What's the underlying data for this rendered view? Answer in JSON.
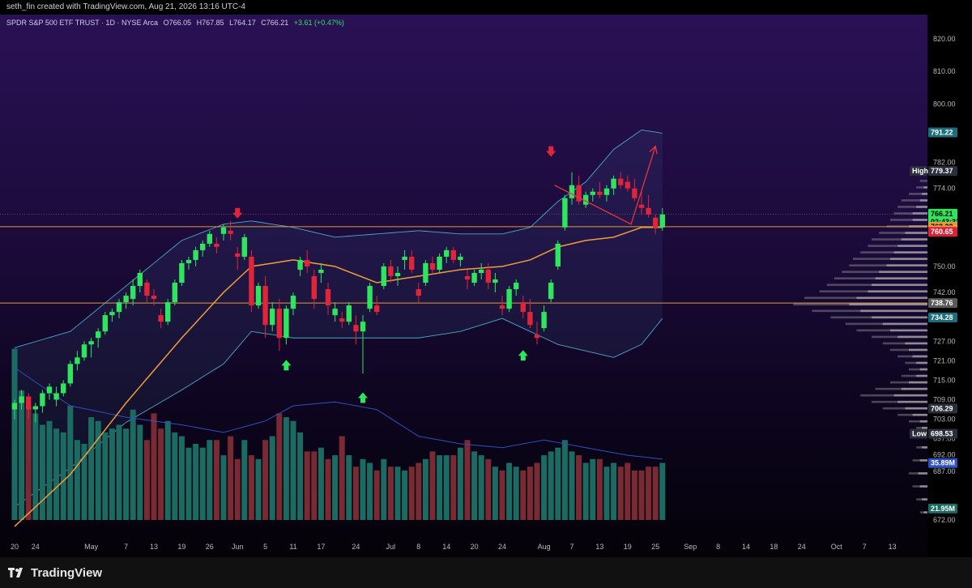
{
  "header": {
    "attribution": "seth_fin created with TradingView.com, Aug 21, 2026 13:16 UTC-4"
  },
  "footer": {
    "logo_text": "TradingView"
  },
  "colors": {
    "bull": "#2ee65e",
    "bear": "#e0243a",
    "bull_vol": "#1c6b62",
    "bear_vol": "#7a2a33",
    "sma": "#f29d38",
    "band": "#4aa8c8",
    "vol_ma": "#3050c0",
    "hline": "#e59a3a",
    "arrow": "#e8333f"
  },
  "chart_data": {
    "type": "candlestick",
    "symbol_line": "SPDR S&P 500 ETF TRUST · 1D · NYSE Arca",
    "ohlc_readout": {
      "O": "O766.05",
      "H": "H767.85",
      "L": "L764.17",
      "C": "C766.21",
      "change": "+3.61 (+0.47%)"
    },
    "ylim": [
      668,
      826
    ],
    "y_ticks": [
      820,
      810,
      800,
      782,
      774,
      750,
      742,
      727,
      721,
      715,
      709,
      703,
      697,
      692,
      687,
      672
    ],
    "x_ticks": [
      {
        "label": "20",
        "bar": 0
      },
      {
        "label": "24",
        "bar": 3
      },
      {
        "label": "May",
        "bar": 11
      },
      {
        "label": "7",
        "bar": 16
      },
      {
        "label": "13",
        "bar": 20
      },
      {
        "label": "19",
        "bar": 24
      },
      {
        "label": "26",
        "bar": 28
      },
      {
        "label": "Jun",
        "bar": 32
      },
      {
        "label": "5",
        "bar": 36
      },
      {
        "label": "11",
        "bar": 40
      },
      {
        "label": "17",
        "bar": 44
      },
      {
        "label": "24",
        "bar": 49
      },
      {
        "label": "Jul",
        "bar": 54
      },
      {
        "label": "8",
        "bar": 58
      },
      {
        "label": "14",
        "bar": 62
      },
      {
        "label": "20",
        "bar": 66
      },
      {
        "label": "24",
        "bar": 70
      },
      {
        "label": "Aug",
        "bar": 76
      },
      {
        "label": "7",
        "bar": 80
      },
      {
        "label": "13",
        "bar": 84
      },
      {
        "label": "19",
        "bar": 88
      },
      {
        "label": "25",
        "bar": 92
      },
      {
        "label": "Sep",
        "bar": 97
      },
      {
        "label": "8",
        "bar": 101
      },
      {
        "label": "14",
        "bar": 105
      },
      {
        "label": "18",
        "bar": 109
      },
      {
        "label": "24",
        "bar": 113
      },
      {
        "label": "Oct",
        "bar": 118
      },
      {
        "label": "7",
        "bar": 122
      },
      {
        "label": "13",
        "bar": 126
      }
    ],
    "candles": [
      [
        706,
        709,
        703,
        708
      ],
      [
        708,
        712,
        706,
        710
      ],
      [
        710,
        711,
        703,
        706
      ],
      [
        706,
        708,
        702,
        707
      ],
      [
        707,
        712,
        705,
        711
      ],
      [
        711,
        714,
        709,
        713
      ],
      [
        709,
        713,
        707,
        711
      ],
      [
        711,
        715,
        710,
        714
      ],
      [
        714,
        721,
        713,
        720
      ],
      [
        720,
        724,
        718,
        722
      ],
      [
        722,
        727,
        721,
        726
      ],
      [
        726,
        728,
        722,
        727
      ],
      [
        728,
        731,
        725,
        730
      ],
      [
        730,
        736,
        729,
        735
      ],
      [
        735,
        737,
        733,
        736
      ],
      [
        736,
        740,
        734,
        739
      ],
      [
        739,
        742,
        737,
        741
      ],
      [
        740,
        746,
        738,
        744
      ],
      [
        744,
        749,
        742,
        748
      ],
      [
        745,
        746,
        739,
        741
      ],
      [
        741,
        743,
        738,
        740
      ],
      [
        735,
        737,
        731,
        733
      ],
      [
        733,
        740,
        732,
        739
      ],
      [
        739,
        746,
        738,
        745
      ],
      [
        745,
        752,
        744,
        751
      ],
      [
        751,
        753,
        749,
        752
      ],
      [
        752,
        756,
        750,
        755
      ],
      [
        755,
        758,
        753,
        757
      ],
      [
        757,
        761,
        756,
        760
      ],
      [
        757,
        759,
        754,
        756
      ],
      [
        760,
        763,
        758,
        762
      ],
      [
        761,
        764,
        758,
        760
      ],
      [
        754,
        756,
        749,
        753
      ],
      [
        753,
        760,
        752,
        759
      ],
      [
        753,
        755,
        736,
        738
      ],
      [
        738,
        745,
        737,
        744
      ],
      [
        744,
        747,
        728,
        732
      ],
      [
        732,
        739,
        730,
        737
      ],
      [
        737,
        740,
        724,
        728
      ],
      [
        728,
        738,
        726,
        737
      ],
      [
        737,
        742,
        735,
        741
      ],
      [
        749,
        753,
        747,
        752
      ],
      [
        752,
        755,
        748,
        750
      ],
      [
        747,
        749,
        737,
        740
      ],
      [
        748,
        751,
        745,
        749
      ],
      [
        743,
        745,
        735,
        738
      ],
      [
        735,
        739,
        733,
        737
      ],
      [
        734,
        736,
        731,
        733
      ],
      [
        733,
        739,
        732,
        738
      ],
      [
        732,
        735,
        726,
        730
      ],
      [
        730,
        735,
        717,
        733
      ],
      [
        737,
        745,
        736,
        744
      ],
      [
        738,
        741,
        735,
        736
      ],
      [
        744,
        751,
        743,
        750
      ],
      [
        750,
        752,
        745,
        747
      ],
      [
        747,
        750,
        744,
        748
      ],
      [
        752,
        755,
        749,
        753
      ],
      [
        753,
        755,
        748,
        749
      ],
      [
        743,
        745,
        739,
        741
      ],
      [
        745,
        752,
        744,
        751
      ],
      [
        751,
        753,
        748,
        749
      ],
      [
        749,
        754,
        748,
        753
      ],
      [
        753,
        756,
        751,
        755
      ],
      [
        755,
        756,
        751,
        752
      ],
      [
        752,
        754,
        750,
        753
      ],
      [
        747,
        749,
        743,
        746
      ],
      [
        745,
        749,
        744,
        748
      ],
      [
        748,
        751,
        746,
        749
      ],
      [
        749,
        751,
        743,
        745
      ],
      [
        745,
        748,
        742,
        746
      ],
      [
        738,
        741,
        735,
        737
      ],
      [
        737,
        744,
        736,
        743
      ],
      [
        743,
        746,
        741,
        745
      ],
      [
        739,
        741,
        734,
        736
      ],
      [
        736,
        740,
        731,
        732
      ],
      [
        729,
        733,
        726,
        728
      ],
      [
        731,
        738,
        730,
        736
      ],
      [
        740,
        746,
        739,
        745
      ],
      [
        750,
        758,
        749,
        757
      ],
      [
        762,
        772,
        761,
        771
      ],
      [
        771,
        779,
        769,
        775
      ],
      [
        775,
        778,
        769,
        770
      ],
      [
        769,
        773,
        768,
        772
      ],
      [
        772,
        774,
        770,
        773
      ],
      [
        773,
        776,
        771,
        772
      ],
      [
        772,
        775,
        770,
        774
      ],
      [
        774,
        778,
        772,
        777
      ],
      [
        777,
        779,
        774,
        775
      ],
      [
        776,
        778,
        773,
        774
      ],
      [
        774,
        777,
        770,
        771
      ],
      [
        769,
        773,
        766,
        768
      ],
      [
        768,
        772,
        765,
        766
      ],
      [
        765,
        766,
        760,
        762
      ],
      [
        762,
        768,
        761,
        766
      ]
    ],
    "volume": [
      45,
      34,
      30,
      28,
      25,
      26,
      24,
      23,
      30,
      21,
      20,
      27,
      26,
      23,
      24,
      25,
      24,
      29,
      25,
      21,
      28,
      24,
      26,
      23,
      22,
      19,
      20,
      19,
      21,
      21,
      17,
      22,
      16,
      21,
      17,
      16,
      21,
      22,
      28,
      27,
      26,
      23,
      18,
      18,
      19,
      16,
      17,
      22,
      17,
      14,
      16,
      15,
      13,
      16,
      14,
      14,
      13,
      14,
      15,
      16,
      18,
      17,
      17,
      17,
      19,
      21,
      18,
      17,
      16,
      14,
      13,
      15,
      14,
      13,
      14,
      15,
      17,
      18,
      19,
      21,
      18,
      17,
      15,
      16,
      16,
      14,
      15,
      14,
      15,
      13,
      13,
      14,
      14,
      15
    ],
    "sma20_key": [
      [
        0,
        670
      ],
      [
        8,
        686
      ],
      [
        16,
        708
      ],
      [
        24,
        728
      ],
      [
        30,
        742
      ],
      [
        34,
        750
      ],
      [
        40,
        752
      ],
      [
        46,
        750
      ],
      [
        52,
        745
      ],
      [
        58,
        747
      ],
      [
        64,
        749
      ],
      [
        70,
        750
      ],
      [
        74,
        752
      ],
      [
        78,
        756
      ],
      [
        82,
        758
      ],
      [
        86,
        759
      ],
      [
        90,
        762
      ],
      [
        93,
        762
      ]
    ],
    "bb_upper_key": [
      [
        0,
        725
      ],
      [
        8,
        730
      ],
      [
        16,
        744
      ],
      [
        24,
        758
      ],
      [
        30,
        763
      ],
      [
        34,
        764
      ],
      [
        40,
        762
      ],
      [
        46,
        759
      ],
      [
        52,
        760
      ],
      [
        58,
        761
      ],
      [
        64,
        760
      ],
      [
        70,
        760
      ],
      [
        74,
        762
      ],
      [
        78,
        770
      ],
      [
        82,
        776
      ],
      [
        86,
        786
      ],
      [
        90,
        792
      ],
      [
        93,
        791
      ]
    ],
    "bb_lower_key": [
      [
        0,
        676
      ],
      [
        8,
        688
      ],
      [
        16,
        702
      ],
      [
        24,
        712
      ],
      [
        30,
        720
      ],
      [
        34,
        730
      ],
      [
        40,
        728
      ],
      [
        46,
        728
      ],
      [
        52,
        728
      ],
      [
        58,
        728
      ],
      [
        64,
        730
      ],
      [
        70,
        734
      ],
      [
        74,
        730
      ],
      [
        78,
        726
      ],
      [
        82,
        724
      ],
      [
        86,
        722
      ],
      [
        90,
        726
      ],
      [
        93,
        734
      ]
    ],
    "vol_ma_key": [
      [
        0,
        40
      ],
      [
        8,
        30
      ],
      [
        16,
        27
      ],
      [
        24,
        25
      ],
      [
        30,
        23
      ],
      [
        36,
        26
      ],
      [
        40,
        30
      ],
      [
        46,
        31
      ],
      [
        52,
        29
      ],
      [
        58,
        22
      ],
      [
        64,
        20
      ],
      [
        70,
        19
      ],
      [
        76,
        21
      ],
      [
        82,
        19
      ],
      [
        88,
        17
      ],
      [
        93,
        16
      ]
    ],
    "h_lines": [
      {
        "price": 762.22,
        "color": "#e59a3a"
      },
      {
        "price": 738.76,
        "color": "#e59a3a"
      }
    ],
    "price_tags": [
      {
        "price": 791.22,
        "text": "791.22",
        "bg": "#1c6e7a",
        "fg": "#ffffff"
      },
      {
        "price": 779.37,
        "text": "779.37",
        "bg": "#2a2f3b",
        "fg": "#ffffff",
        "label": "High"
      },
      {
        "price": 766.21,
        "text": "766.21",
        "bg": "#2ee65e",
        "fg": "#000000",
        "sub": "02:43:33"
      },
      {
        "price": 762.22,
        "text": "762.22",
        "bg": "#e59a3a",
        "fg": "#000000"
      },
      {
        "price": 761.06,
        "text": "761.06",
        "bg": "#f29d38",
        "fg": "#000000"
      },
      {
        "price": 760.65,
        "text": "760.65",
        "bg": "#d9233b",
        "fg": "#ffffff"
      },
      {
        "price": 738.76,
        "text": "738.76",
        "bg": "#5a5a5a",
        "fg": "#ffffff"
      },
      {
        "price": 734.28,
        "text": "734.28",
        "bg": "#1c6e7a",
        "fg": "#ffffff"
      },
      {
        "price": 706.29,
        "text": "706.29",
        "bg": "#2a2f3b",
        "fg": "#ffffff"
      },
      {
        "price": 698.53,
        "text": "698.53",
        "bg": "#2a2f3b",
        "fg": "#ffffff",
        "label": "Low"
      },
      {
        "price": 689.5,
        "text": "35.89M",
        "bg": "#3050c0",
        "fg": "#ffffff"
      },
      {
        "price": 675.5,
        "text": "21.95M",
        "bg": "#1c6b62",
        "fg": "#ffffff"
      }
    ],
    "markers": [
      {
        "type": "down",
        "bar": 32,
        "price": 766
      },
      {
        "type": "up",
        "bar": 39,
        "price": 720
      },
      {
        "type": "up",
        "bar": 50,
        "price": 710
      },
      {
        "type": "up",
        "bar": 73,
        "price": 723
      },
      {
        "type": "down",
        "bar": 77,
        "price": 785
      }
    ],
    "arrow_path": [
      [
        77.5,
        775
      ],
      [
        88.5,
        763
      ],
      [
        92,
        787
      ]
    ],
    "volume_profile": [
      [
        776,
        4,
        0
      ],
      [
        774,
        6,
        2
      ],
      [
        772,
        10,
        3
      ],
      [
        770,
        14,
        4
      ],
      [
        768,
        16,
        6
      ],
      [
        766,
        18,
        8
      ],
      [
        764,
        20,
        8
      ],
      [
        762,
        22,
        10
      ],
      [
        760,
        26,
        12
      ],
      [
        758,
        30,
        14
      ],
      [
        756,
        32,
        16
      ],
      [
        754,
        36,
        18
      ],
      [
        752,
        40,
        20
      ],
      [
        750,
        42,
        22
      ],
      [
        748,
        46,
        26
      ],
      [
        746,
        50,
        28
      ],
      [
        744,
        54,
        30
      ],
      [
        742,
        58,
        32
      ],
      [
        740,
        66,
        38
      ],
      [
        738,
        72,
        42
      ],
      [
        736,
        62,
        36
      ],
      [
        734,
        52,
        30
      ],
      [
        732,
        44,
        24
      ],
      [
        730,
        38,
        20
      ],
      [
        728,
        30,
        16
      ],
      [
        726,
        24,
        12
      ],
      [
        724,
        20,
        10
      ],
      [
        722,
        16,
        8
      ],
      [
        720,
        12,
        6
      ],
      [
        718,
        10,
        4
      ],
      [
        716,
        14,
        6
      ],
      [
        714,
        20,
        10
      ],
      [
        712,
        28,
        14
      ],
      [
        710,
        36,
        18
      ],
      [
        708,
        30,
        16
      ],
      [
        706,
        24,
        12
      ],
      [
        704,
        16,
        8
      ],
      [
        702,
        10,
        4
      ],
      [
        700,
        6,
        3
      ],
      [
        698,
        4,
        2
      ],
      [
        694,
        6,
        3
      ],
      [
        690,
        8,
        4
      ],
      [
        686,
        10,
        5
      ],
      [
        682,
        8,
        4
      ],
      [
        678,
        6,
        3
      ],
      [
        674,
        4,
        2
      ]
    ]
  }
}
